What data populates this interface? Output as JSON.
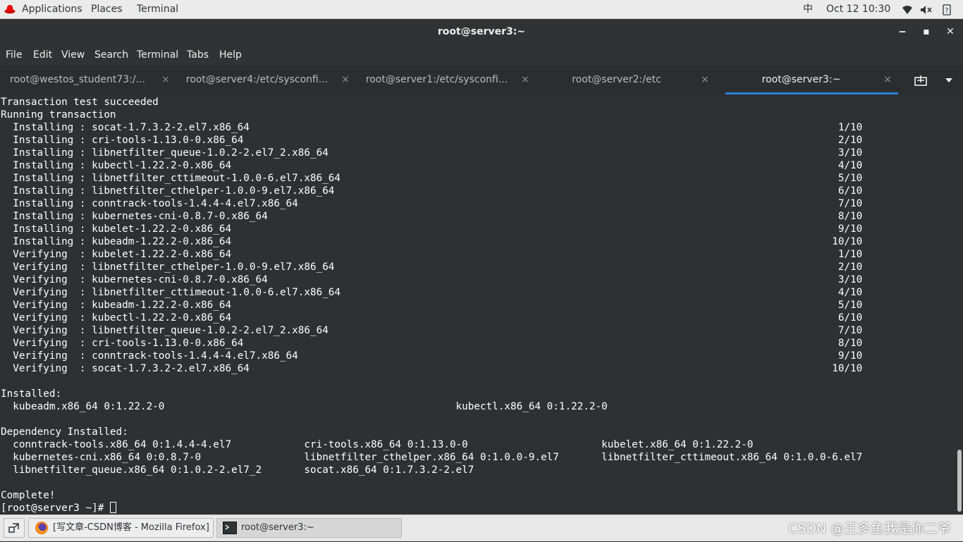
{
  "topbar": {
    "applications": "Applications",
    "places": "Places",
    "terminal": "Terminal",
    "input_method": "中",
    "clock": "Oct 12  10:30",
    "icons": [
      "redhat-icon",
      "wifi-icon",
      "volume-icon",
      "power-icon"
    ]
  },
  "window": {
    "title": "root@server3:~",
    "minimize": "‒",
    "maximize": "▪",
    "close": "✕"
  },
  "menubar": [
    "File",
    "Edit",
    "View",
    "Search",
    "Terminal",
    "Tabs",
    "Help"
  ],
  "tabs": [
    {
      "label": "root@westos_student73:/..."
    },
    {
      "label": "root@server4:/etc/sysconfi..."
    },
    {
      "label": "root@server1:/etc/sysconfi..."
    },
    {
      "label": "root@server2:/etc"
    },
    {
      "label": "root@server3:~",
      "active": true
    }
  ],
  "tab_close_glyph": "×",
  "terminal_lines": [
    "Transaction test succeeded",
    "Running transaction",
    "  Installing : socat-1.7.3.2-2.el7.x86_64                                                                                                 1/10",
    "  Installing : cri-tools-1.13.0-0.x86_64                                                                                                  2/10",
    "  Installing : libnetfilter_queue-1.0.2-2.el7_2.x86_64                                                                                    3/10",
    "  Installing : kubectl-1.22.2-0.x86_64                                                                                                    4/10",
    "  Installing : libnetfilter_cttimeout-1.0.0-6.el7.x86_64                                                                                  5/10",
    "  Installing : libnetfilter_cthelper-1.0.0-9.el7.x86_64                                                                                   6/10",
    "  Installing : conntrack-tools-1.4.4-4.el7.x86_64                                                                                         7/10",
    "  Installing : kubernetes-cni-0.8.7-0.x86_64                                                                                              8/10",
    "  Installing : kubelet-1.22.2-0.x86_64                                                                                                    9/10",
    "  Installing : kubeadm-1.22.2-0.x86_64                                                                                                   10/10",
    "  Verifying  : kubelet-1.22.2-0.x86_64                                                                                                    1/10",
    "  Verifying  : libnetfilter_cthelper-1.0.0-9.el7.x86_64                                                                                   2/10",
    "  Verifying  : kubernetes-cni-0.8.7-0.x86_64                                                                                              3/10",
    "  Verifying  : libnetfilter_cttimeout-1.0.0-6.el7.x86_64                                                                                  4/10",
    "  Verifying  : kubeadm-1.22.2-0.x86_64                                                                                                    5/10",
    "  Verifying  : kubectl-1.22.2-0.x86_64                                                                                                    6/10",
    "  Verifying  : libnetfilter_queue-1.0.2-2.el7_2.x86_64                                                                                    7/10",
    "  Verifying  : cri-tools-1.13.0-0.x86_64                                                                                                  8/10",
    "  Verifying  : conntrack-tools-1.4.4-4.el7.x86_64                                                                                         9/10",
    "  Verifying  : socat-1.7.3.2-2.el7.x86_64                                                                                                10/10",
    "",
    "Installed:",
    "  kubeadm.x86_64 0:1.22.2-0                                                kubectl.x86_64 0:1.22.2-0",
    "",
    "Dependency Installed:",
    "  conntrack-tools.x86_64 0:1.4.4-4.el7            cri-tools.x86_64 0:1.13.0-0                      kubelet.x86_64 0:1.22.2-0",
    "  kubernetes-cni.x86_64 0:0.8.7-0                 libnetfilter_cthelper.x86_64 0:1.0.0-9.el7       libnetfilter_cttimeout.x86_64 0:1.0.0-6.el7",
    "  libnetfilter_queue.x86_64 0:1.0.2-2.el7_2       socat.x86_64 0:1.7.3.2-2.el7",
    "",
    "Complete!"
  ],
  "prompt": "[root@server3 ~]# ",
  "taskbar": {
    "firefox": "[写文章-CSDN博客 - Mozilla Firefox]",
    "terminal": "root@server3:~",
    "watermark": "CSDN @王多鱼我是你二爷"
  }
}
